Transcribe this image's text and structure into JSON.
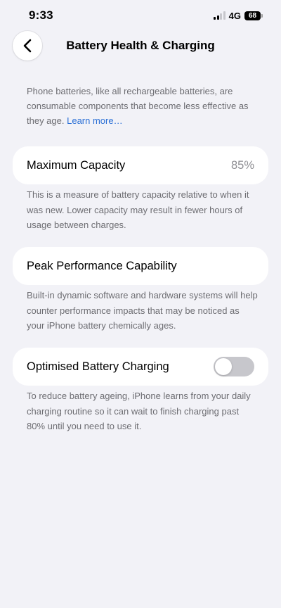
{
  "status_bar": {
    "time": "9:33",
    "network": "4G",
    "battery_level": "68"
  },
  "nav": {
    "title": "Battery Health & Charging",
    "back_icon": "chevron-left-icon"
  },
  "intro": {
    "text": "Phone batteries, like all rechargeable batteries, are consumable components that become less effective as they age. ",
    "link": "Learn more…"
  },
  "maximum_capacity": {
    "label": "Maximum Capacity",
    "value": "85%",
    "footnote": "This is a measure of battery capacity relative to when it was new. Lower capacity may result in fewer hours of usage between charges."
  },
  "peak_performance": {
    "label": "Peak Performance Capability",
    "footnote": "Built-in dynamic software and hardware systems will help counter performance impacts that may be noticed as your iPhone battery chemically ages."
  },
  "optimised_charging": {
    "label": "Optimised Battery Charging",
    "enabled": false,
    "footnote": "To reduce battery ageing, iPhone learns from your daily charging routine so it can wait to finish charging past 80% until you need to use it."
  },
  "colors": {
    "background": "#f2f2f7",
    "card": "#ffffff",
    "secondary_text": "#6d6d72",
    "link": "#2a6fd6",
    "toggle_off": "#c7c7cc"
  }
}
